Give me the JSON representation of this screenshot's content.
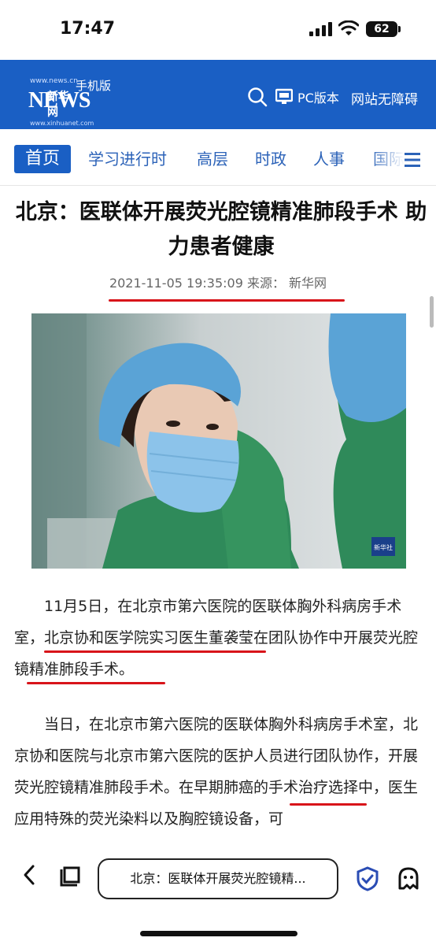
{
  "status_bar": {
    "time": "17:47",
    "battery": "62",
    "icons": [
      "signal-icon",
      "wifi-icon",
      "battery-icon"
    ]
  },
  "header": {
    "logo_site": "www.news.cn",
    "logo_news": "NEWS",
    "logo_cn": "新华网",
    "logo_sub": "www.xinhuanet.com",
    "mobile_label": "手机版",
    "pc_label": "PC版本",
    "accessibility_label": "网站无障碍",
    "bg_color": "#1a5fc4"
  },
  "nav": {
    "active_tab": "首页",
    "tabs": [
      "学习进行时",
      "高层",
      "时政",
      "人事",
      "国际"
    ]
  },
  "article": {
    "title": "北京：医联体开展荧光腔镜精准肺段手术 助力患者健康",
    "meta": "2021-11-05 19:35:09 来源： 新华网",
    "photo_badge": "新华社",
    "paragraphs": [
      "11月5日，在北京市第六医院的医联体胸外科病房手术室，北京协和医学院实习医生董袭莹在团队协作中开展荧光腔镜精准肺段手术。",
      "当日，在北京市第六医院的医联体胸外科病房手术室，北京协和医院与北京市第六医院的医护人员进行团队协作，开展荧光腔镜精准肺段手术。在早期肺癌的手术治疗选择中，医生应用特殊的荧光染料以及胸腔镜设备，可"
    ],
    "highlight_color": "#d8141a"
  },
  "toolbar": {
    "url_text": "北京：医联体开展荧光腔镜精..."
  }
}
